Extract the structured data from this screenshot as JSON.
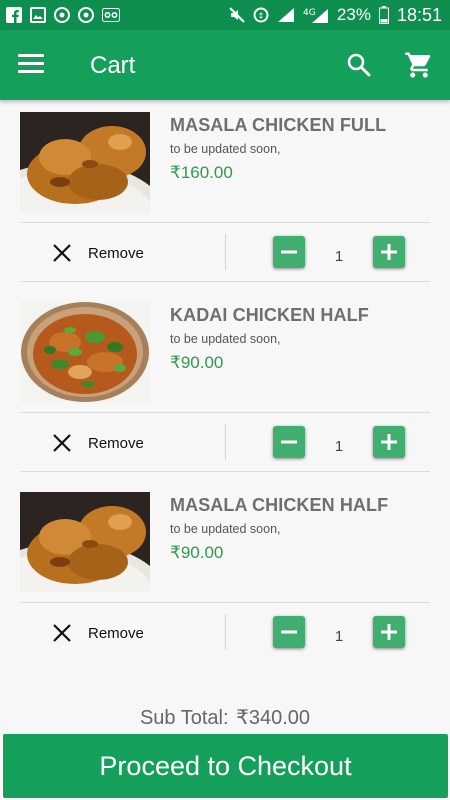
{
  "status_bar": {
    "battery": "23%",
    "time": "18:51",
    "network": "4G"
  },
  "app_bar": {
    "title": "Cart"
  },
  "items": [
    {
      "name": "MASALA CHICKEN FULL",
      "description": "to be updated soon,",
      "price": "₹160.00",
      "quantity": "1",
      "remove_label": "Remove",
      "image": "masala-chicken-photo"
    },
    {
      "name": "KADAI CHICKEN HALF",
      "description": "to be updated soon,",
      "price": "₹90.00",
      "quantity": "1",
      "remove_label": "Remove",
      "image": "kadai-chicken-photo"
    },
    {
      "name": "MASALA CHICKEN HALF",
      "description": "to be updated soon,",
      "price": "₹90.00",
      "quantity": "1",
      "remove_label": "Remove",
      "image": "masala-chicken-photo"
    }
  ],
  "footer": {
    "subtotal_label": "Sub Total:",
    "subtotal_value": "₹340.00",
    "checkout_label": "Proceed to Checkout"
  },
  "colors": {
    "status_bar": "#0e8f4f",
    "app_bar": "#14a05a",
    "price": "#2f9a4e",
    "qty_button": "#3fae6f"
  }
}
